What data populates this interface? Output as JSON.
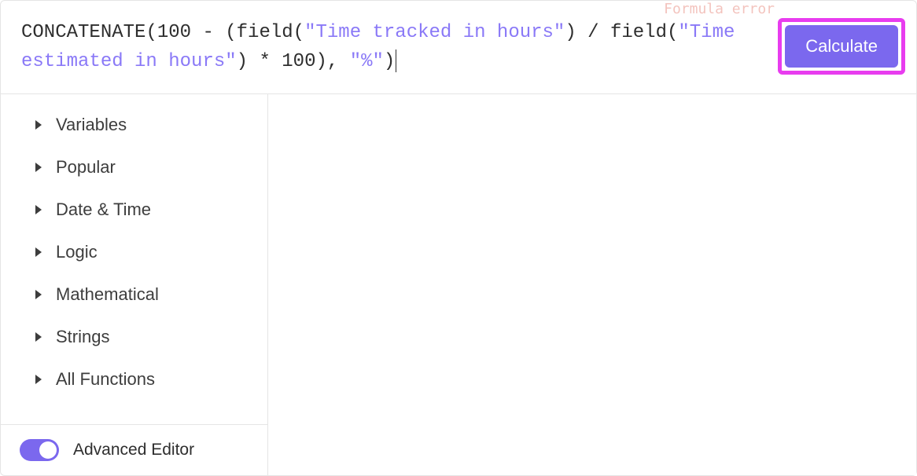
{
  "formula": {
    "tokens": [
      {
        "t": "fn",
        "v": "CONCATENATE"
      },
      {
        "t": "plain",
        "v": "(100 - (field("
      },
      {
        "t": "str",
        "v": "\"Time tracked in hours\""
      },
      {
        "t": "plain",
        "v": ") / field("
      },
      {
        "t": "str",
        "v": "\"Time estimated in hours\""
      },
      {
        "t": "plain",
        "v": ") * 100), "
      },
      {
        "t": "str",
        "v": "\"%\""
      },
      {
        "t": "plain",
        "v": ")"
      }
    ]
  },
  "error_hint": "Formula error",
  "calculate_label": "Calculate",
  "categories": [
    {
      "label": "Variables"
    },
    {
      "label": "Popular"
    },
    {
      "label": "Date & Time"
    },
    {
      "label": "Logic"
    },
    {
      "label": "Mathematical"
    },
    {
      "label": "Strings"
    },
    {
      "label": "All Functions"
    }
  ],
  "advanced_editor": {
    "label": "Advanced Editor",
    "on": true
  },
  "colors": {
    "accent": "#7b68ee",
    "highlight_border": "#e83cef",
    "string": "#8a79f7"
  }
}
